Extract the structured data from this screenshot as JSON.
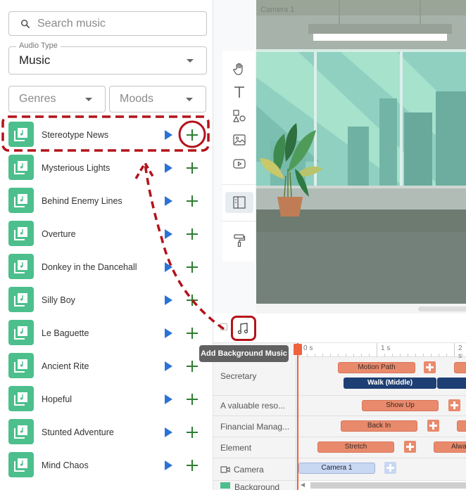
{
  "search": {
    "placeholder": "Search music",
    "icon": "search-icon"
  },
  "audio_type": {
    "legend": "Audio Type",
    "value": "Music"
  },
  "filters": {
    "genres": "Genres",
    "moods": "Moods"
  },
  "tracks": [
    {
      "title": "Stereotype News",
      "highlighted": true
    },
    {
      "title": "Mysterious Lights"
    },
    {
      "title": "Behind Enemy Lines"
    },
    {
      "title": "Overture"
    },
    {
      "title": "Donkey in the Dancehall"
    },
    {
      "title": "Silly Boy"
    },
    {
      "title": "Le Baguette"
    },
    {
      "title": "Ancient Rite"
    },
    {
      "title": "Hopeful"
    },
    {
      "title": "Stunted Adventure"
    },
    {
      "title": "Mind Chaos"
    }
  ],
  "toolbar": {
    "tools": [
      "hand-icon",
      "text-icon",
      "shapes-icon",
      "image-icon",
      "video-icon",
      "panel-icon",
      "paint-roller-icon"
    ]
  },
  "canvas": {
    "camera_label": "Camera 1"
  },
  "timeline": {
    "tooltip": "Add Background Music",
    "ruler": [
      "0 s",
      "1 s",
      "2 s"
    ],
    "rows": [
      {
        "label": "Secretary",
        "chips": [
          "Motion Path",
          "Walk (Middle)"
        ]
      },
      {
        "label": "A valuable reso...",
        "chips": [
          "Show Up"
        ]
      },
      {
        "label": "Financial Manag...",
        "chips": [
          "Back In"
        ]
      },
      {
        "label": "Element",
        "chips": [
          "Stretch",
          "Alwa"
        ]
      },
      {
        "label": "Camera",
        "chips": [
          "Camera 1"
        ]
      },
      {
        "label": "Background",
        "chips": []
      }
    ]
  },
  "colors": {
    "accent_red": "#b3131b",
    "thumb_green": "#4cbf8c",
    "play_blue": "#2a73d6",
    "chip_orange": "#e98a6c",
    "chip_navy": "#1e3f73"
  }
}
